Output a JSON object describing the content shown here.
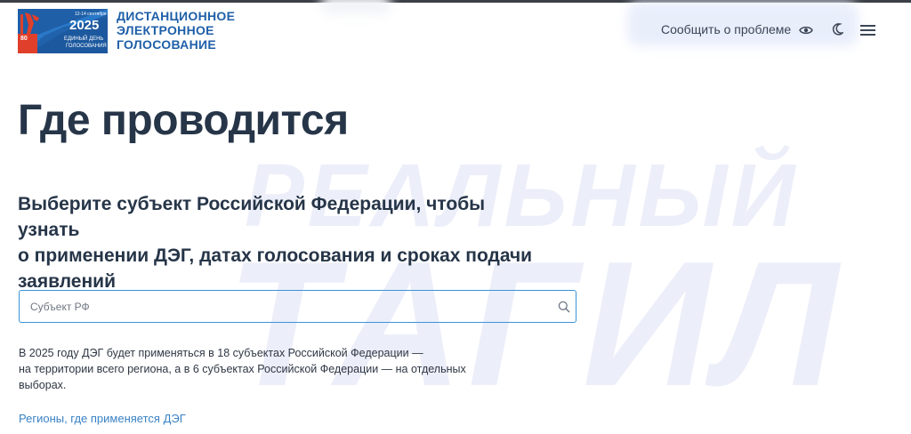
{
  "header": {
    "logo": {
      "year": "2025",
      "dates": "12-14 сентября",
      "subtitle_line1": "ЕДИНЫЙ ДЕНЬ",
      "subtitle_line2": "ГОЛОСОВАНИЯ",
      "anniversary": "80"
    },
    "title_lines": [
      "ДИСТАНЦИОННОЕ",
      "ЭЛЕКТРОННОЕ",
      "ГОЛОСОВАНИЕ"
    ],
    "report_link": "Сообщить о проблеме"
  },
  "watermark": {
    "line1": "РЕАЛЬНЫЙ",
    "line2": "ТАГИЛ"
  },
  "main": {
    "title": "Где проводится",
    "subheading_lines": [
      "Выберите субъект Российской Федерации, чтобы узнать",
      "о применении ДЭГ, датах голосования и сроках подачи",
      "заявлений"
    ],
    "search": {
      "placeholder": "Субъект РФ",
      "value": ""
    },
    "info_lines": [
      "В 2025 году ДЭГ будет применяться в 18 субъектах Российской Федерации —",
      "на территории всего региона, а в 6 субъектах Российской Федерации — на отдельных",
      "выборах."
    ],
    "regions_link": "Регионы, где применяется ДЭГ"
  },
  "icons": [
    "eye-icon",
    "moon-icon",
    "menu-icon",
    "search-icon"
  ],
  "colors": {
    "brand_blue": "#1f5fa8",
    "title_text": "#263548",
    "link": "#3a82c4",
    "input_border": "#3a93d6",
    "watermark": "#eceef9"
  }
}
